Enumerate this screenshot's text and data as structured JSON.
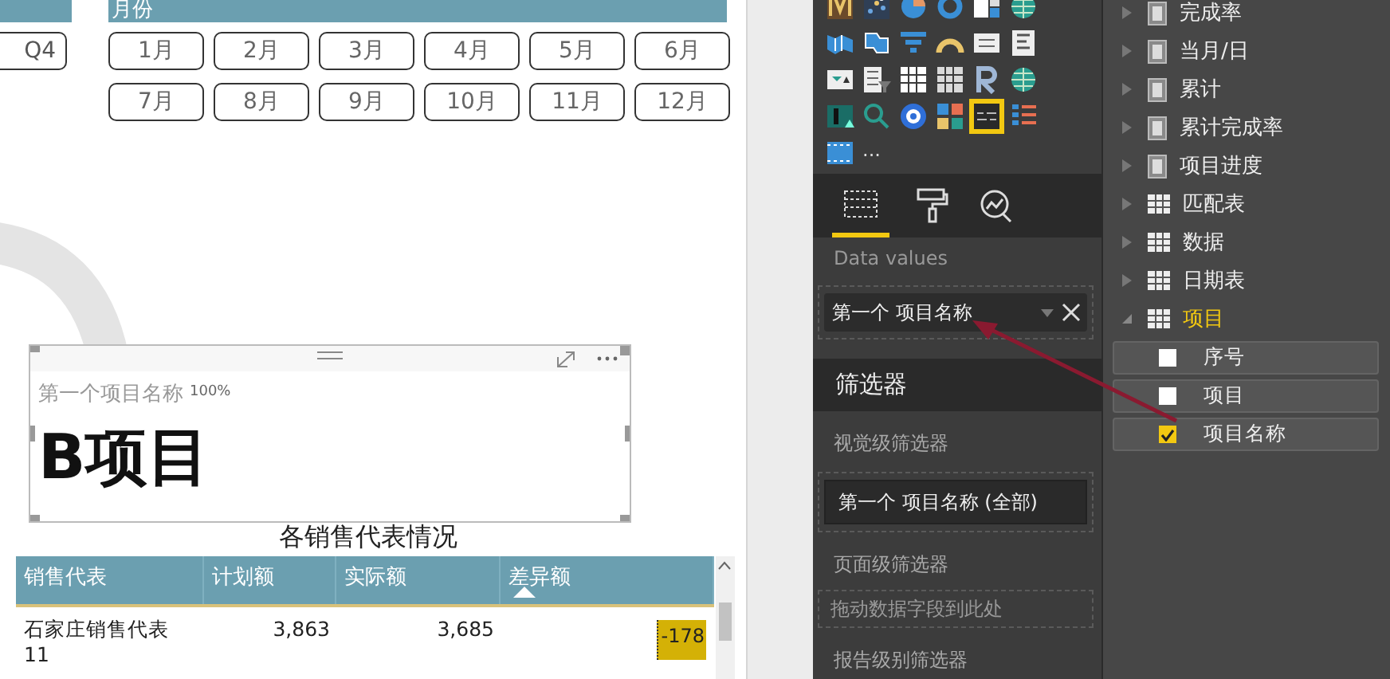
{
  "canvas": {
    "quarter_slicer": {
      "buttons": [
        "Q4"
      ]
    },
    "month_slicer": {
      "title": "月份",
      "buttons": [
        "1月",
        "2月",
        "3月",
        "4月",
        "5月",
        "6月",
        "7月",
        "8月",
        "9月",
        "10月",
        "11月",
        "12月"
      ]
    },
    "card": {
      "label": "第一个项目名称",
      "overlay": "100%",
      "value": "B项目"
    },
    "table": {
      "title": "各销售代表情况",
      "columns": [
        {
          "label": "销售代表",
          "sorted": false
        },
        {
          "label": "计划额",
          "sorted": false
        },
        {
          "label": "实际额",
          "sorted": false
        },
        {
          "label": "差异额",
          "sorted": true
        }
      ],
      "rows": [
        [
          "石家庄销售代表 11",
          "3,863",
          "3,685",
          "-178"
        ]
      ]
    }
  },
  "visualizations": {
    "items": [
      {
        "kind": "ribbon",
        "selected": false
      },
      {
        "kind": "scatter",
        "selected": false
      },
      {
        "kind": "pie",
        "selected": false
      },
      {
        "kind": "donut",
        "selected": false
      },
      {
        "kind": "treemap",
        "selected": false
      },
      {
        "kind": "globe",
        "selected": false
      },
      {
        "kind": "map",
        "selected": false
      },
      {
        "kind": "shapemap",
        "selected": false
      },
      {
        "kind": "funnel",
        "selected": false
      },
      {
        "kind": "gauge",
        "selected": false
      },
      {
        "kind": "card",
        "selected": false
      },
      {
        "kind": "multicard",
        "selected": false
      },
      {
        "kind": "kpi",
        "selected": false
      },
      {
        "kind": "slicer",
        "selected": false
      },
      {
        "kind": "table",
        "selected": false
      },
      {
        "kind": "matrix",
        "selected": false
      },
      {
        "kind": "r",
        "selected": false
      },
      {
        "kind": "globe",
        "selected": false
      },
      {
        "kind": "image",
        "selected": false
      },
      {
        "kind": "search",
        "selected": false
      },
      {
        "kind": "circle",
        "selected": false
      },
      {
        "kind": "tiles",
        "selected": false
      },
      {
        "kind": "text",
        "selected": true
      },
      {
        "kind": "list",
        "selected": false
      },
      {
        "kind": "film",
        "selected": false
      }
    ],
    "more": "...",
    "tabs": [
      {
        "kind": "fields",
        "selected": true
      },
      {
        "kind": "format",
        "selected": false
      },
      {
        "kind": "analytics",
        "selected": false
      }
    ],
    "well_label": "Data values",
    "well_field": "第一个 项目名称",
    "filters_title": "筛选器",
    "visual_filters_label": "视觉级筛选器",
    "visual_filter": "第一个 项目名称 (全部)",
    "page_filters_label": "页面级筛选器",
    "page_drop_hint": "拖动数据字段到此处",
    "report_filters_label": "报告级别筛选器"
  },
  "fields": [
    {
      "label": "完成率",
      "kind": "measure",
      "expanded": false
    },
    {
      "label": "当月/日",
      "kind": "measure",
      "expanded": false
    },
    {
      "label": "累计",
      "kind": "measure",
      "expanded": false
    },
    {
      "label": "累计完成率",
      "kind": "measure",
      "expanded": false
    },
    {
      "label": "项目进度",
      "kind": "measure",
      "expanded": false
    },
    {
      "label": "匹配表",
      "kind": "table",
      "expanded": false
    },
    {
      "label": "数据",
      "kind": "table",
      "expanded": false
    },
    {
      "label": "日期表",
      "kind": "table",
      "expanded": false
    },
    {
      "label": "项目",
      "kind": "table",
      "expanded": true,
      "children": [
        {
          "label": "序号",
          "checked": false
        },
        {
          "label": "项目",
          "checked": false
        },
        {
          "label": "项目名称",
          "checked": true
        }
      ]
    }
  ]
}
